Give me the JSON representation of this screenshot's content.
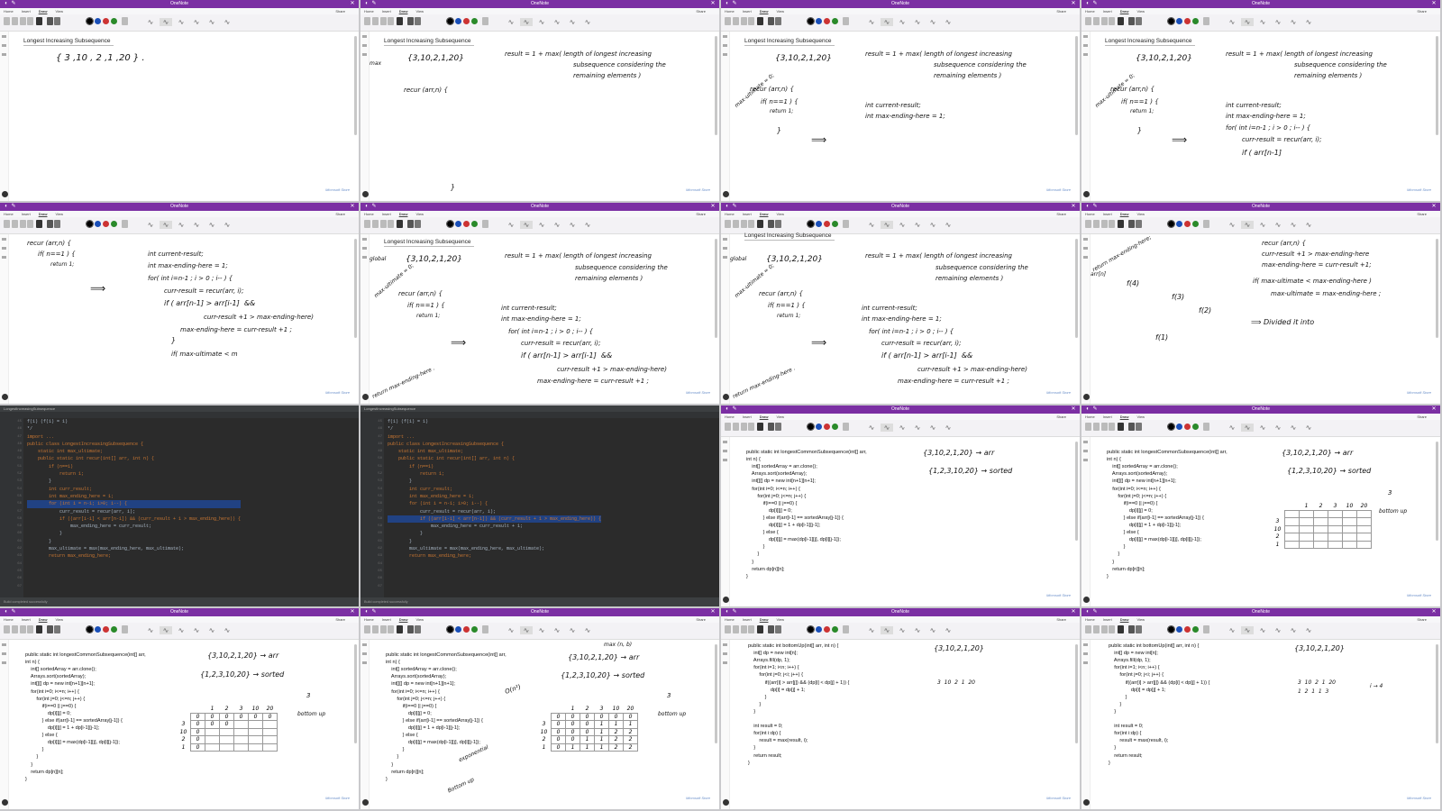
{
  "app": {
    "title": "OneNote",
    "menus": [
      "Home",
      "Insert",
      "Draw",
      "View"
    ],
    "share": "Share"
  },
  "page_title": "Longest Increasing Subsequence",
  "brand": "Microsoft Store",
  "tiles": {
    "t1": {
      "hw": [
        "{ 3 ,10 , 2 ,1 ,20 } ."
      ]
    },
    "t2": {
      "hw": [
        "{3,10,2,1,20}",
        "result = 1 + max( length of longest increasing",
        "subsequence considering the",
        "remaining elements )",
        "recur (arr,n) {",
        "max",
        "}"
      ]
    },
    "t3": {
      "hw": [
        "{3,10,2,1,20}",
        "result = 1 + max( length of longest increasing",
        "subsequence considering the",
        "remaining elements )",
        "max-ultimate = 0;",
        "recur (arr,n) {",
        "if( n==1 ) {",
        "return 1;",
        "}",
        "int current-result;",
        "int max-ending-here = 1;",
        "⟹"
      ]
    },
    "t4": {
      "hw": [
        "{3,10,2,1,20}",
        "result = 1 + max( length of longest increasing",
        "subsequence considering the",
        "remaining elements )",
        "max-ultimate = 0;",
        "recur (arr,n) {",
        "if( n==1 ) {",
        "return 1;",
        "}",
        "int current-result;",
        "int max-ending-here = 1;",
        "for( int i=n-1 ; i > 0 ; i-- ) {",
        "curr-result = recur(arr, i);",
        "if ( arr[n-1]",
        "⟹"
      ]
    },
    "t5": {
      "hw": [
        "recur (arr,n) {",
        "if( n==1 ) {",
        "return 1;",
        "int current-result;",
        "int max-ending-here = 1;",
        "for( int i=n-1 ; i > 0 ; i-- ) {",
        "curr-result = recur(arr, i);",
        "if ( arr[n-1] > arr[i-1]  && ",
        "curr-result +1 > max-ending-here)",
        "max-ending-here = curr-result +1 ;",
        "}",
        "if( max-ultimate < m",
        "⟹"
      ]
    },
    "t6": {
      "hw": [
        "{3,10,2,1,20}",
        "result = 1 + max( length of longest increasing",
        "subsequence considering the",
        "remaining elements )",
        "global",
        "max-ultimate = 0;",
        "recur (arr,n) {",
        "if( n==1 ) {",
        "return 1;",
        "int current-result;",
        "int max-ending-here = 1;",
        "for( int i=n-1 ; i > 0 ; i-- ) {",
        "curr-result = recur(arr, i);",
        "if ( arr[n-1] > arr[i-1]  &&",
        "curr-result +1 > max-ending-here)",
        "max-ending-here = curr-result +1 ;",
        "return max-ending-here .",
        "⟹"
      ]
    },
    "t7": {
      "hw": [
        "{3,10,2,1,20}",
        "result = 1 + max( length of longest increasing",
        "subsequence considering the",
        "remaining elements )",
        "global",
        "max-ultimate = 0;",
        "recur (arr,n) {",
        "if( n==1 ) {",
        "return 1;",
        "int current-result;",
        "int max-ending-here = 1;",
        "for( int i=n-1 ; i > 0 ; i-- ) {",
        "curr-result = recur(arr, i);",
        "if ( arr[n-1] > arr[i-1]  &&",
        "curr-result +1 > max-ending-here)",
        "max-ending-here = curr-result +1 ;",
        "return max-ending-here .",
        "⟹"
      ]
    },
    "t8": {
      "hw": [
        "return max-ending-here;",
        "recur (arr,n) {",
        "curr-result +1 > max-ending-here",
        "max-ending-here = curr-result +1;",
        "arr[n]",
        "f(4)",
        "f(3)",
        "f(2)",
        "f(1)",
        "if( max-ultimate < max-ending-here )",
        "max-ultimate = max-ending-here ;",
        "⟹ Divided it into"
      ]
    },
    "t9": {
      "path": "LongestIncreasingSubsequence",
      "lines": [
        "f(1) (f(1) = 1)",
        "*/",
        "",
        "import ...",
        "",
        "public class LongestIncreasingSubsequence {",
        "",
        "    static int max_ultimate;",
        "",
        "    public static int recur(int[] arr, int n) {",
        "        if (n==1)",
        "            return 1;",
        "        }",
        "        int curr_result;",
        "        int max_ending_here = 1;",
        "        for (int i = n-1; i>0; i--) {",
        "            curr_result = recur(arr, i);",
        "            if ((arr[i-1] < arr[n-1]) && (curr_result + 1 > max_ending_here)) {",
        "                max_ending_here = curr_result;",
        "            }",
        "        }",
        "        max_ultimate = max(max_ending_here, max_ultimate);",
        "        return max_ending_here;"
      ],
      "status": "Build completed successfully"
    },
    "t10": {
      "path": "LongestIncreasingSubsequence",
      "lines": [
        "f(1) (f(1) = 1)",
        "*/",
        "",
        "import ...",
        "",
        "public class LongestIncreasingSubsequence {",
        "",
        "    static int max_ultimate;",
        "",
        "    public static int recur(int[] arr, int n) {",
        "        if (n==1)",
        "            return 1;",
        "        }",
        "        int curr_result;",
        "        int max_ending_here = 1;",
        "        for (int i = n-1; i>0; i--) {",
        "            curr_result = recur(arr, i);",
        "            if ((arr[i-1] < arr[n-1]) && (curr_result + 1 > max_ending_here)) {",
        "                max_ending_here = curr_result + 1;",
        "            }",
        "        }",
        "        max_ultimate = max(max_ending_here, max_ultimate);",
        "        return max_ending_here;"
      ],
      "status": "Build completed successfully"
    },
    "t11": {
      "code": [
        "public static int longestCommonSubsequence(int[] arr,",
        "int n) {",
        "    int[] sortedArray = arr.clone();",
        "    Arrays.sort(sortedArray);",
        "    int[][] dp = new int[n+1][n+1];",
        "    for(int i=0; i<=n; i++) {",
        "        for(int j=0; j<=n; j++) {",
        "            if(i==0 || j==0) {",
        "                dp[i][j] = 0;",
        "            } else if(arr[i-1] == sortedArray[j-1]) {",
        "                dp[i][j] = 1 + dp[i-1][j-1];",
        "            } else {",
        "                dp[i][j] = max(dp[i-1][j], dp[i][j-1]);",
        "            }",
        "        }",
        "    }",
        "    return dp[n][n];",
        "}"
      ],
      "hw": [
        "{3,10,2,1,20} → arr",
        "{1,2,3,10,20} → sorted"
      ]
    },
    "t12": {
      "code": [
        "public static int longestCommonSubsequence(int[] arr,",
        "int n) {",
        "    int[] sortedArray = arr.clone();",
        "    Arrays.sort(sortedArray);",
        "    int[][] dp = new int[n+1][n+1];",
        "    for(int i=0; i<=n; i++) {",
        "        for(int j=0; j<=n; j++) {",
        "            if(i==0 || j==0) {",
        "                dp[i][j] = 0;",
        "            } else if(arr[i-1] == sortedArray[j-1]) {",
        "                dp[i][j] = 1 + dp[i-1][j-1];",
        "            } else {",
        "                dp[i][j] = max(dp[i-1][j], dp[i][j-1]);",
        "            }",
        "        }",
        "    }",
        "    return dp[n][n];",
        "}"
      ],
      "hw": [
        "{3,10,2,1,20} → arr",
        "{1,2,3,10,20} → sorted",
        "3",
        "bottom up"
      ],
      "grid_cols": [
        "",
        "1",
        "2",
        "3",
        "10",
        "20"
      ],
      "grid_rows": [
        "",
        "3",
        "10",
        "2",
        "1",
        "20"
      ]
    },
    "t13": {
      "code": [
        "public static int longestCommonSubsequence(int[] arr,",
        "int n) {",
        "    int[] sortedArray = arr.clone();",
        "    Arrays.sort(sortedArray);",
        "    int[][] dp = new int[n+1][n+1];",
        "    for(int i=0; i<=n; i++) {",
        "        for(int j=0; j<=n; j++) {",
        "            if(i==0 || j==0) {",
        "                dp[i][j] = 0;",
        "            } else if(arr[i-1] == sortedArray[j-1]) {",
        "                dp[i][j] = 1 + dp[i-1][j-1];",
        "            } else {",
        "                dp[i][j] = max(dp[i-1][j], dp[i][j-1]);",
        "            }",
        "        }",
        "    }",
        "    return dp[n][n];",
        "}"
      ],
      "hw": [
        "{3,10,2,1,20} → arr",
        "{1,2,3,10,20} → sorted",
        "3",
        "bottom up"
      ],
      "grid_cols": [
        "",
        "1",
        "2",
        "3",
        "10",
        "20"
      ],
      "grid_rows": [
        "",
        "3",
        "10",
        "2",
        "1",
        "20"
      ],
      "grid_vals": [
        [
          "0",
          "0",
          "0",
          "0",
          "0",
          "0"
        ],
        [
          "0",
          "0",
          "0",
          "",
          "",
          ""
        ],
        [
          "0",
          "",
          "",
          "",
          "",
          ""
        ],
        [
          "0",
          "",
          "",
          "",
          "",
          ""
        ],
        [
          "0",
          "",
          "",
          "",
          "",
          ""
        ],
        [
          "0",
          "",
          "",
          "",
          "",
          ""
        ]
      ]
    },
    "t14": {
      "code": [
        "public static int longestCommonSubsequence(int[] arr,",
        "int n) {",
        "    int[] sortedArray = arr.clone();",
        "    Arrays.sort(sortedArray);",
        "    int[][] dp = new int[n+1][n+1];",
        "    for(int i=0; i<=n; i++) {",
        "        for(int j=0; j<=n; j++) {",
        "            if(i==0 || j==0) {",
        "                dp[i][j] = 0;",
        "            } else if(arr[i-1] == sortedArray[j-1]) {",
        "                dp[i][j] = 1 + dp[i-1][j-1];",
        "            } else {",
        "                dp[i][j] = max(dp[i-1][j], dp[i][j-1]);",
        "            }",
        "        }",
        "    }",
        "    return dp[n][n];",
        "}"
      ],
      "hw": [
        "max (n, b)",
        "{3,10,2,1,20} → arr",
        "{1,2,3,10,20} → sorted",
        "O(n²)",
        "3",
        "bottom up",
        "exponential",
        "Bottom up"
      ],
      "grid_cols": [
        "",
        "1",
        "2",
        "3",
        "10",
        "20"
      ],
      "grid_rows": [
        "",
        "3",
        "10",
        "2",
        "1",
        "20"
      ],
      "grid_vals": [
        [
          "0",
          "0",
          "0",
          "0",
          "0",
          "0"
        ],
        [
          "0",
          "0",
          "0",
          "1",
          "1",
          "1"
        ],
        [
          "0",
          "0",
          "0",
          "1",
          "2",
          "2"
        ],
        [
          "0",
          "0",
          "1",
          "1",
          "2",
          "2"
        ],
        [
          "0",
          "1",
          "1",
          "1",
          "2",
          "2"
        ],
        [
          "0",
          "1",
          "1",
          "1",
          "2",
          "3"
        ]
      ]
    },
    "t15": {
      "code": [
        "public static int bottomUp(int[] arr, int n) {",
        "    int[] dp = new int[n];",
        "    Arrays.fill(dp, 1);",
        "    for(int i=1; i<n; i++) {",
        "        for(int j=0; j<i; j++) {",
        "            if((arr[i] > arr[j]) && (dp[i] < dp[j] + 1)) {",
        "                dp[i] = dp[j] + 1;",
        "            }",
        "        }",
        "    }",
        "",
        "    int result = 0;",
        "    for(int i:dp) {",
        "        result = max(result, i);",
        "    }",
        "    return result;",
        "}"
      ],
      "hw": [
        "{3,10,2,1,20}",
        "3  10  2  1  20"
      ]
    },
    "t16": {
      "code": [
        "public static int bottomUp(int[] arr, int n) {",
        "    int[] dp = new int[n];",
        "    Arrays.fill(dp, 1);",
        "    for(int i=1; i<n; i++) {",
        "        for(int j=0; j<i; j++) {",
        "            if((arr[i] > arr[j]) && (dp[i] < dp[j] + 1)) {",
        "                dp[i] = dp[j] + 1;",
        "            }",
        "        }",
        "    }",
        "",
        "    int result = 0;",
        "    for(int i:dp) {",
        "        result = max(result, i);",
        "    }",
        "    return result;",
        "}"
      ],
      "hw": [
        "{3,10,2,1,20}",
        "3  10  2  1  20",
        "1  2  1  1  3",
        "i → 4"
      ]
    }
  }
}
